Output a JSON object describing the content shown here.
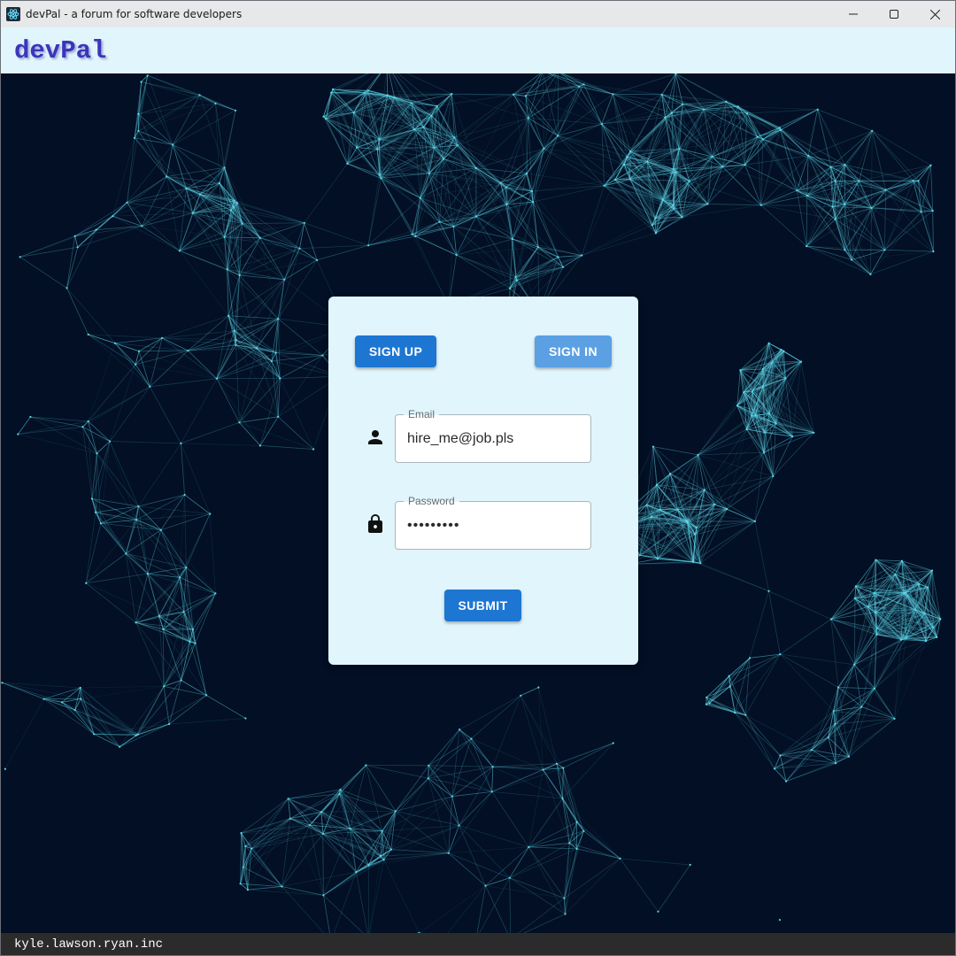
{
  "window": {
    "title": "devPal - a forum for software developers",
    "icon": "react-atom-icon",
    "controls": [
      "minimize-icon",
      "maximize-icon",
      "close-icon"
    ]
  },
  "header": {
    "brand": "devPal"
  },
  "auth": {
    "tabs": {
      "sign_up_label": "SIGN UP",
      "sign_in_label": "SIGN IN"
    },
    "email": {
      "label": "Email",
      "value": "hire_me@job.pls",
      "icon": "person-icon"
    },
    "password": {
      "label": "Password",
      "value": "•••••••••",
      "icon": "lock-icon"
    },
    "submit_label": "SUBMIT"
  },
  "footer": {
    "text": "kyle.lawson.ryan.inc"
  },
  "colors": {
    "background": "#020f24",
    "network_line": "#5fd8ea",
    "header_bg": "#e0f5fc",
    "brand": "#3b36b8",
    "card_bg": "#e1f5fc",
    "primary": "#1d76d2",
    "secondary": "#5aa0e3",
    "footer_bg": "#2b2b2b"
  }
}
